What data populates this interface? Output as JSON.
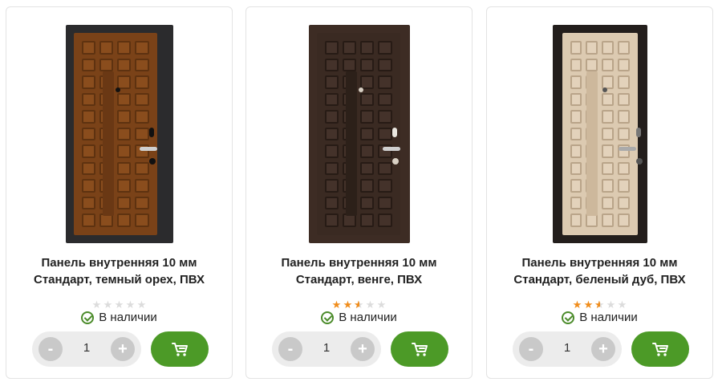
{
  "products": [
    {
      "door_color": "dark-walnut",
      "title_line1": "Панель внутренняя 10 мм",
      "title_line2": "Стандарт, темный орех, ПВХ",
      "rating": 0,
      "stock": "В наличии",
      "quantity": "1",
      "minus_label": "-",
      "plus_label": "+"
    },
    {
      "door_color": "wenge",
      "title_line1": "Панель внутренняя 10 мм",
      "title_line2": "Стандарт, венге, ПВХ",
      "rating": 2.5,
      "stock": "В наличии",
      "quantity": "1",
      "minus_label": "-",
      "plus_label": "+"
    },
    {
      "door_color": "bleached-oak",
      "title_line1": "Панель внутренняя 10 мм",
      "title_line2": "Стандарт, беленый дуб, ПВХ",
      "rating": 2.5,
      "stock": "В наличии",
      "quantity": "1",
      "minus_label": "-",
      "plus_label": "+"
    }
  ],
  "icons": {
    "cart": "cart-icon",
    "stock": "check-circle-icon",
    "star": "star-icon"
  },
  "colors": {
    "accent_green": "#4c9a27",
    "star_orange": "#f08c1a",
    "star_empty": "#dcdcdc"
  }
}
